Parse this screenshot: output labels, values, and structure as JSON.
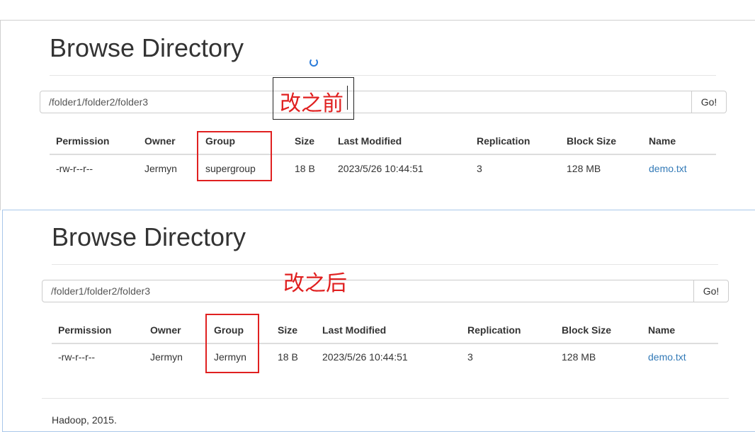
{
  "before": {
    "title": "Browse Directory",
    "path_value": "/folder1/folder2/folder3",
    "go_label": "Go!",
    "annotation": "改之前",
    "headers": [
      "Permission",
      "Owner",
      "Group",
      "Size",
      "Last Modified",
      "Replication",
      "Block Size",
      "Name"
    ],
    "row": {
      "permission": "-rw-r--r--",
      "owner": "Jermyn",
      "group": "supergroup",
      "size": "18 B",
      "last_modified": "2023/5/26 10:44:51",
      "replication": "3",
      "block_size": "128 MB",
      "name": "demo.txt"
    }
  },
  "after": {
    "title": "Browse Directory",
    "path_value": "/folder1/folder2/folder3",
    "go_label": "Go!",
    "annotation": "改之后",
    "headers": [
      "Permission",
      "Owner",
      "Group",
      "Size",
      "Last Modified",
      "Replication",
      "Block Size",
      "Name"
    ],
    "row": {
      "permission": "-rw-r--r--",
      "owner": "Jermyn",
      "group": "Jermyn",
      "size": "18 B",
      "last_modified": "2023/5/26 10:44:51",
      "replication": "3",
      "block_size": "128 MB",
      "name": "demo.txt"
    },
    "footer": "Hadoop, 2015."
  },
  "colors": {
    "highlight": "#e02020",
    "link": "#337ab7"
  }
}
